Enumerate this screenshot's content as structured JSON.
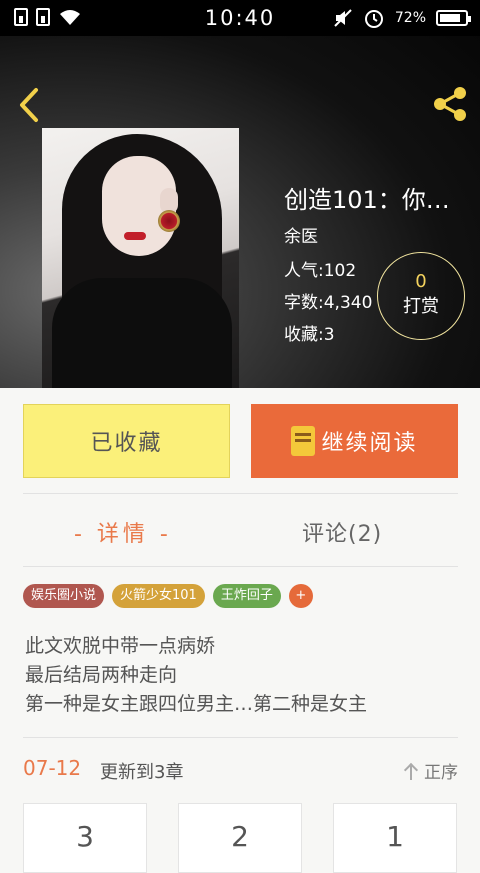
{
  "status_bar": {
    "time": "10:40",
    "battery": "72%",
    "battery_level": 0.72
  },
  "book": {
    "title": "创造101：你…",
    "author": "余医",
    "popularity": "人气:102",
    "word_count": "字数:4,340",
    "favorites": "收藏:3",
    "reward_count": "0",
    "reward_label": "打赏"
  },
  "actions": {
    "collect": "已收藏",
    "read": "继续阅读"
  },
  "tabs": {
    "detail": "- 详情 -",
    "comments": "评论(2)"
  },
  "tags": [
    {
      "label": "娱乐圈小说",
      "color": "#b0574f"
    },
    {
      "label": "火箭少女101",
      "color": "#d4a23a"
    },
    {
      "label": "王炸回子",
      "color": "#6aa84f"
    }
  ],
  "tag_add": "+",
  "description": [
    "此文欢脱中带一点病娇",
    "最后结局两种走向",
    "第一种是女主跟四位男主…第二种是女主"
  ],
  "update": {
    "date": "07-12",
    "text": "更新到3章",
    "sort": "正序"
  },
  "chapters": [
    "3",
    "2",
    "1"
  ]
}
